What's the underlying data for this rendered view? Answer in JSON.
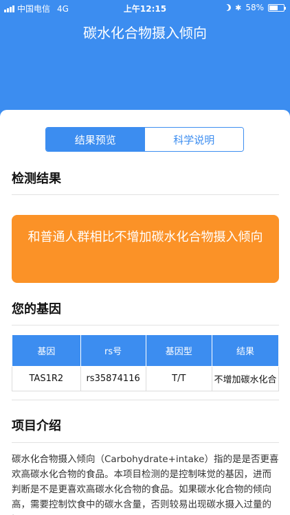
{
  "status_bar": {
    "carrier": "中国电信",
    "network": "4G",
    "time": "上午12:15",
    "battery_text": "58%",
    "battery_level": 58
  },
  "header": {
    "title": "碳水化合物摄入倾向"
  },
  "tabs": [
    {
      "label": "结果预览",
      "active": true
    },
    {
      "label": "科学说明",
      "active": false
    }
  ],
  "sections": {
    "result_title": "检测结果",
    "genes_title": "您的基因",
    "intro_title": "项目介绍"
  },
  "result": {
    "text": "和普通人群相比不增加碳水化合物摄入倾向"
  },
  "gene_table": {
    "headers": [
      "基因",
      "rs号",
      "基因型",
      "结果"
    ],
    "rows": [
      [
        "TAS1R2",
        "rs35874116",
        "T/T",
        "不增加碳水化合"
      ]
    ]
  },
  "intro": {
    "text": "碳水化合物摄入倾向（Carbohydrate+intake）指的是是否更喜欢高碳水化合物的食品。本项目检测的是控制味觉的基因，进而判断是不是更喜欢高碳水化合物的食品。如果碳水化合物的倾向高，需要控制饮食中的碳水含量，否则较易出现碳水摄入过量的问题。"
  },
  "colors": {
    "primary": "#3c8df0",
    "accent_orange": "#fb9227",
    "divider": "#e2e2e2"
  }
}
